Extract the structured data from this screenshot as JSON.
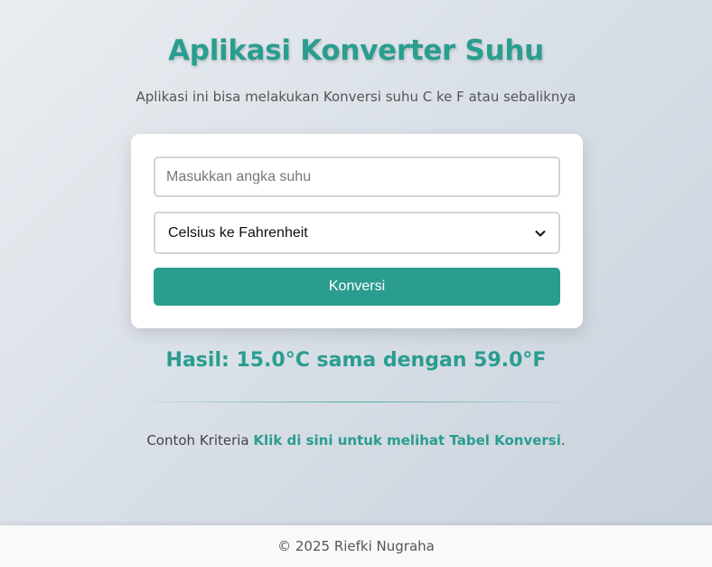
{
  "header": {
    "title": "Aplikasi Konverter Suhu",
    "subtitle": "Aplikasi ini bisa melakukan Konversi suhu C ke F atau sebaliknya"
  },
  "form": {
    "input_placeholder": "Masukkan angka suhu",
    "input_value": "",
    "select_value": "Celsius ke Fahrenheit",
    "select_icon": "chevron-down-icon",
    "button_label": "Konversi"
  },
  "result": {
    "text": "Hasil: 15.0°C sama dengan 59.0°F"
  },
  "criteria": {
    "prefix": "Contoh Kriteria ",
    "link_text": "Klik di sini untuk melihat Tabel Konversi",
    "suffix": "."
  },
  "footer": {
    "text": "© 2025 Riefki Nugraha"
  },
  "colors": {
    "accent": "#2a9d8f",
    "card_background": "#ffffff",
    "footer_background": "#f8f9fb"
  }
}
